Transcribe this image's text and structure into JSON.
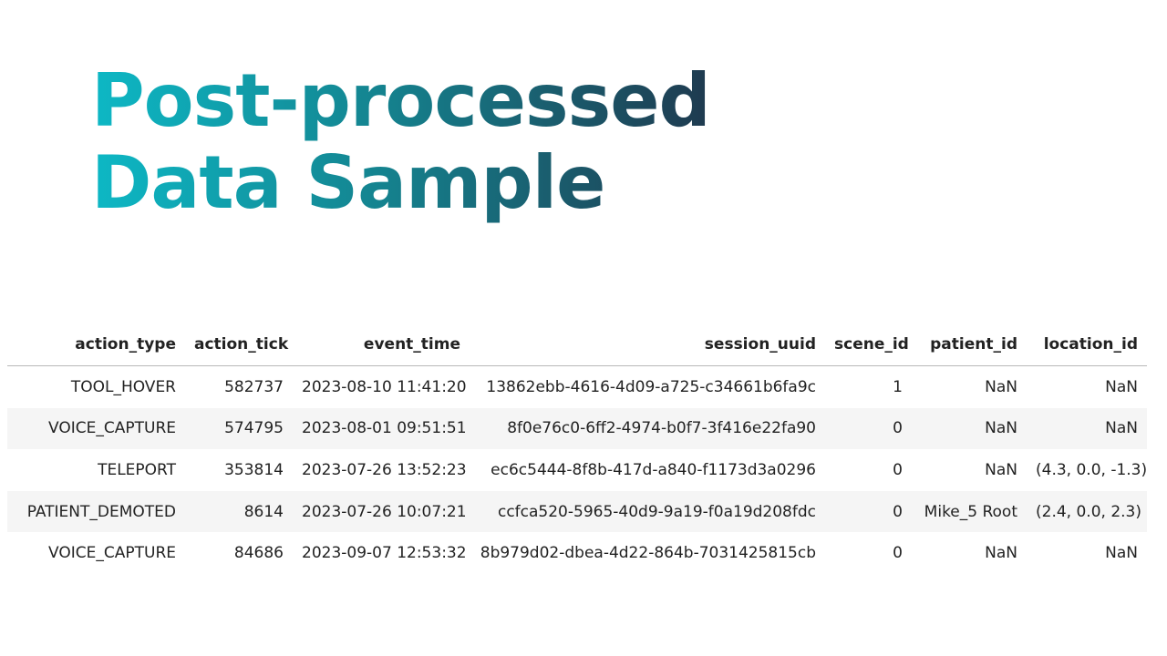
{
  "title": {
    "line1": "Post-processed",
    "line2": "Data Sample"
  },
  "table": {
    "columns": [
      "action_type",
      "action_tick",
      "event_time",
      "session_uuid",
      "scene_id",
      "patient_id",
      "location_id"
    ],
    "rows": [
      [
        "TOOL_HOVER",
        "582737",
        "2023-08-10 11:41:20",
        "13862ebb-4616-4d09-a725-c34661b6fa9c",
        "1",
        "NaN",
        "NaN"
      ],
      [
        "VOICE_CAPTURE",
        "574795",
        "2023-08-01 09:51:51",
        "8f0e76c0-6ff2-4974-b0f7-3f416e22fa90",
        "0",
        "NaN",
        "NaN"
      ],
      [
        "TELEPORT",
        "353814",
        "2023-07-26 13:52:23",
        "ec6c5444-8f8b-417d-a840-f1173d3a0296",
        "0",
        "NaN",
        "(4.3, 0.0, -1.3)"
      ],
      [
        "PATIENT_DEMOTED",
        "8614",
        "2023-07-26 10:07:21",
        "ccfca520-5965-40d9-9a19-f0a19d208fdc",
        "0",
        "Mike_5 Root",
        "(2.4, 0.0, 2.3)"
      ],
      [
        "VOICE_CAPTURE",
        "84686",
        "2023-09-07 12:53:32",
        "8b979d02-dbea-4d22-864b-7031425815cb",
        "0",
        "NaN",
        "NaN"
      ]
    ]
  }
}
